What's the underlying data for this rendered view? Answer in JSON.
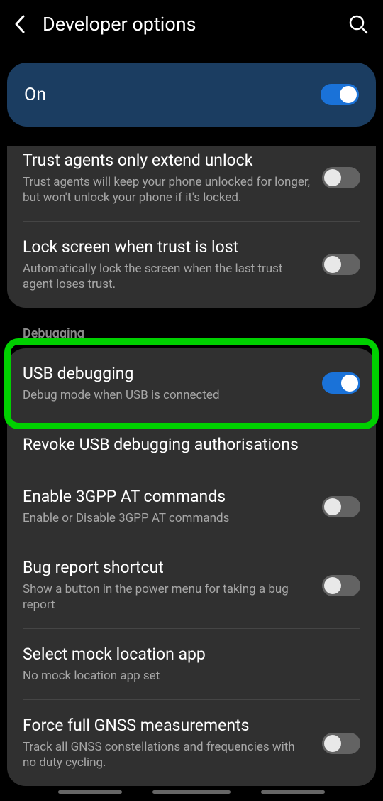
{
  "header": {
    "title": "Developer options"
  },
  "master": {
    "label": "On",
    "state": true
  },
  "group1": [
    {
      "title": "Trust agents only extend unlock",
      "sub": "Trust agents will keep your phone unlocked for longer, but won't unlock your phone if it's locked.",
      "toggle": false
    },
    {
      "title": "Lock screen when trust is lost",
      "sub": "Automatically lock the screen when the last trust agent loses trust.",
      "toggle": false
    }
  ],
  "section2_header": "Debugging",
  "group2": [
    {
      "title": "USB debugging",
      "sub": "Debug mode when USB is connected",
      "toggle": true,
      "highlighted": true
    },
    {
      "title": "Revoke USB debugging authorisations",
      "sub": null,
      "toggle": null
    },
    {
      "title": "Enable 3GPP AT commands",
      "sub": "Enable or Disable 3GPP AT commands",
      "toggle": false
    },
    {
      "title": "Bug report shortcut",
      "sub": "Show a button in the power menu for taking a bug report",
      "toggle": false
    },
    {
      "title": "Select mock location app",
      "sub": "No mock location app set",
      "toggle": null
    },
    {
      "title": "Force full GNSS measurements",
      "sub": "Track all GNSS constellations and frequencies with no duty cycling.",
      "toggle": false
    }
  ]
}
